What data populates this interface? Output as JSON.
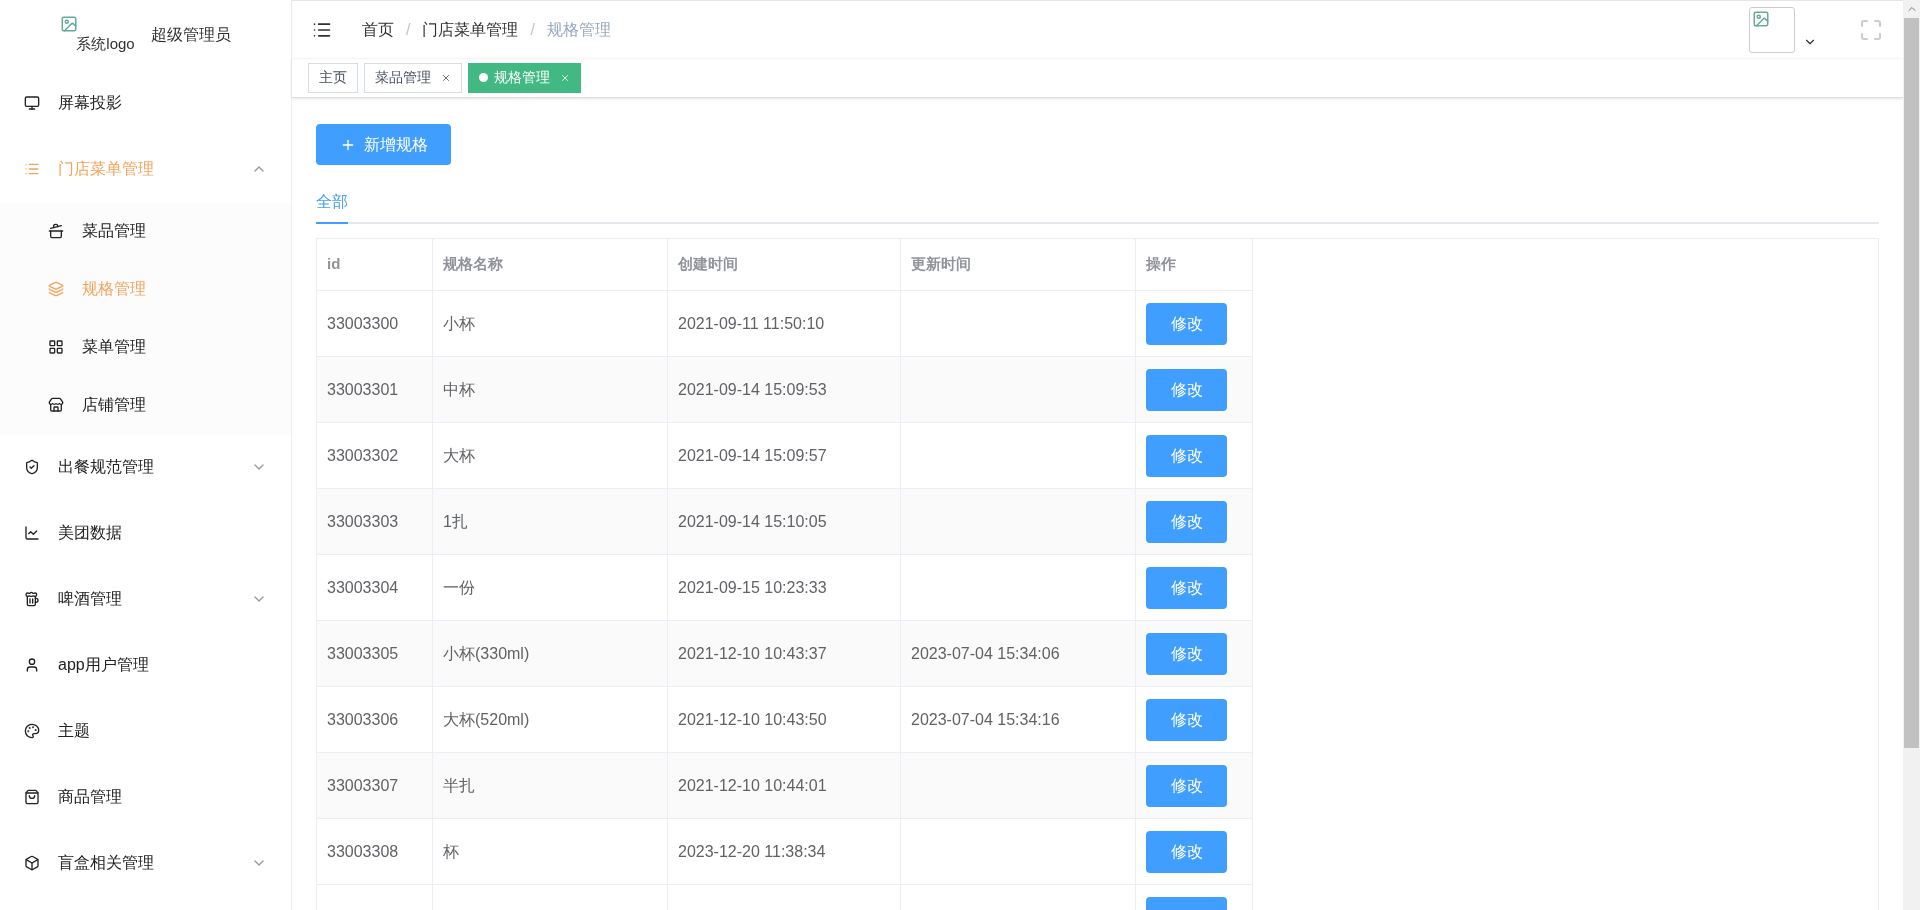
{
  "sidebar": {
    "logo_alt": "系统logo",
    "user": "超级管理员",
    "items": [
      {
        "label": "屏幕投影",
        "selected": false
      },
      {
        "label": "门店菜单管理",
        "expanded": true,
        "children": [
          {
            "label": "菜品管理",
            "selected": false
          },
          {
            "label": "规格管理",
            "selected": true
          },
          {
            "label": "菜单管理",
            "selected": false
          },
          {
            "label": "店铺管理",
            "selected": false
          }
        ]
      },
      {
        "label": "出餐规范管理",
        "expanded": false
      },
      {
        "label": "美团数据",
        "selected": false
      },
      {
        "label": "啤酒管理",
        "expanded": false
      },
      {
        "label": "app用户管理",
        "selected": false
      },
      {
        "label": "主题",
        "selected": false
      },
      {
        "label": "商品管理",
        "selected": false
      },
      {
        "label": "盲盒相关管理",
        "expanded": false
      }
    ]
  },
  "breadcrumb": [
    {
      "label": "首页"
    },
    {
      "separator": "/",
      "label": "门店菜单管理"
    },
    {
      "separator": "/",
      "label": "规格管理"
    }
  ],
  "page_tabs": [
    {
      "label": "主页",
      "selected": false,
      "closable": false
    },
    {
      "label": "菜品管理",
      "selected": false,
      "closable": true
    },
    {
      "label": "规格管理",
      "selected": true,
      "closable": true
    }
  ],
  "add_button": "新增规格",
  "filter_tabs": [
    {
      "label": "全部",
      "selected": true
    }
  ],
  "table": {
    "columns": [
      "id",
      "规格名称",
      "创建时间",
      "更新时间",
      "操作"
    ],
    "rows": [
      {
        "id": "33003300",
        "name": "小杯",
        "created": "2021-09-11 11:50:10",
        "updated": "",
        "action": "修改"
      },
      {
        "id": "33003301",
        "name": "中杯",
        "created": "2021-09-14 15:09:53",
        "updated": "",
        "action": "修改"
      },
      {
        "id": "33003302",
        "name": "大杯",
        "created": "2021-09-14 15:09:57",
        "updated": "",
        "action": "修改"
      },
      {
        "id": "33003303",
        "name": "1扎",
        "created": "2021-09-14 15:10:05",
        "updated": "",
        "action": "修改"
      },
      {
        "id": "33003304",
        "name": "一份",
        "created": "2021-09-15 10:23:33",
        "updated": "",
        "action": "修改"
      },
      {
        "id": "33003305",
        "name": "小杯(330ml)",
        "created": "2021-12-10 10:43:37",
        "updated": "2023-07-04 15:34:06",
        "action": "修改"
      },
      {
        "id": "33003306",
        "name": "大杯(520ml)",
        "created": "2021-12-10 10:43:50",
        "updated": "2023-07-04 15:34:16",
        "action": "修改"
      },
      {
        "id": "33003307",
        "name": "半扎",
        "created": "2021-12-10 10:44:01",
        "updated": "",
        "action": "修改"
      },
      {
        "id": "33003308",
        "name": "杯",
        "created": "2023-12-20 11:38:34",
        "updated": "",
        "action": "修改"
      }
    ]
  }
}
